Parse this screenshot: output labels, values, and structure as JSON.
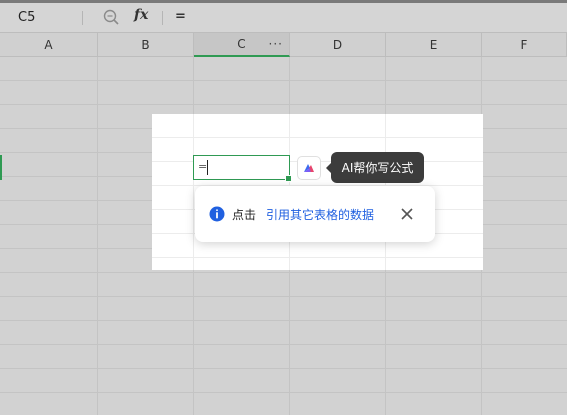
{
  "formula_bar": {
    "cell_ref": "C5",
    "fx_label": "fx",
    "formula": "="
  },
  "columns": [
    "A",
    "B",
    "C",
    "D",
    "E",
    "F"
  ],
  "active_column": "C",
  "column_menu": "···",
  "editing_cell": {
    "content": "="
  },
  "ai_tooltip": "AI帮你写公式",
  "hint": {
    "prefix": "点击",
    "link_text": "引用其它表格的数据"
  },
  "colors": {
    "accent_green": "#2f9a53",
    "link_blue": "#2060e0",
    "tooltip_bg": "#3c3c3c"
  },
  "icons": [
    "zoom-formula-icon",
    "fx-icon",
    "ai-assistant-icon",
    "info-icon",
    "close-icon",
    "more-icon"
  ]
}
